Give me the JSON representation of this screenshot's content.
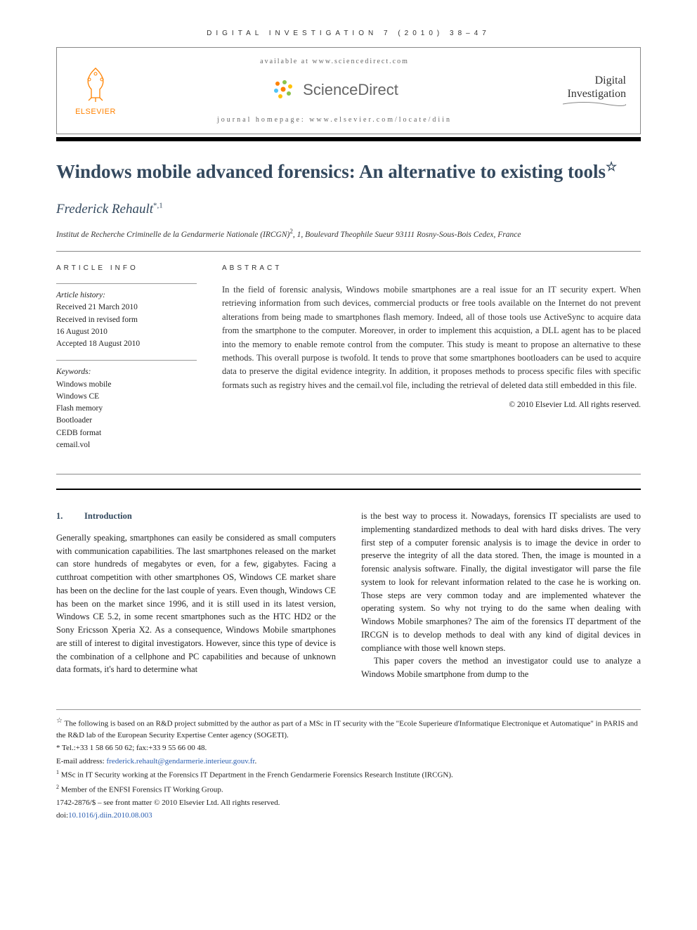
{
  "journalHeader": "DIGITAL INVESTIGATION 7 (2010) 38–47",
  "availableAt": "available at www.sciencedirect.com",
  "sdText": "ScienceDirect",
  "journalHomepage": "journal homepage: www.elsevier.com/locate/diin",
  "publisherName": "ELSEVIER",
  "journalCover": "Digital Investigation",
  "title": "Windows mobile advanced forensics: An alternative to existing tools",
  "authors": "Frederick Rehault",
  "authorMarks": "*,1",
  "affiliation": "Institut de Recherche Criminelle de la Gendarmerie Nationale (IRCGN)",
  "affiliationSup": "2",
  "affiliationRest": ", 1, Boulevard Theophile Sueur 93111 Rosny-Sous-Bois Cedex, France",
  "articleInfoHeading": "ARTICLE INFO",
  "abstractHeading": "ABSTRACT",
  "history": {
    "label": "Article history:",
    "received": "Received 21 March 2010",
    "revised1": "Received in revised form",
    "revised2": "16 August 2010",
    "accepted": "Accepted 18 August 2010"
  },
  "keywords": {
    "label": "Keywords:",
    "items": [
      "Windows mobile",
      "Windows CE",
      "Flash memory",
      "Bootloader",
      "CEDB format",
      "cemail.vol"
    ]
  },
  "abstract": "In the field of forensic analysis, Windows mobile smartphones are a real issue for an IT security expert. When retrieving information from such devices, commercial products or free tools available on the Internet do not prevent alterations from being made to smartphones flash memory. Indeed, all of those tools use ActiveSync to acquire data from the smartphone to the computer. Moreover, in order to implement this acquistion, a DLL agent has to be placed into the memory to enable remote control from the computer. This study is meant to propose an alternative to these methods. This overall purpose is twofold. It tends to prove that some smartphones bootloaders can be used to acquire data to preserve the digital evidence integrity. In addition, it proposes methods to process specific files with specific formats such as registry hives and the cemail.vol file, including the retrieval of deleted data still embedded in this file.",
  "copyright": "© 2010 Elsevier Ltd. All rights reserved.",
  "section1": {
    "num": "1.",
    "title": "Introduction"
  },
  "col1": "Generally speaking, smartphones can easily be considered as small computers with communication capabilities. The last smartphones released on the market can store hundreds of megabytes or even, for a few, gigabytes. Facing a cutthroat competition with other smartphones OS, Windows CE market share has been on the decline for the last couple of years. Even though, Windows CE has been on the market since 1996, and it is still used in its latest version, Windows CE 5.2, in some recent smartphones such as the HTC HD2 or the Sony Ericsson Xperia X2. As a consequence, Windows Mobile smartphones are still of interest to digital investigators. However, since this type of device is the combination of a cellphone and PC capabilities and because of unknown data formats, it's hard to determine what",
  "col2p1": "is the best way to process it. Nowadays, forensics IT specialists are used to implementing standardized methods to deal with hard disks drives. The very first step of a computer forensic analysis is to image the device in order to preserve the integrity of all the data stored. Then, the image is mounted in a forensic analysis software. Finally, the digital investigator will parse the file system to look for relevant information related to the case he is working on. Those steps are very common today and are implemented whatever the operating system. So why not trying to do the same when dealing with Windows Mobile smarphones? The aim of the forensics IT department of the IRCGN is to develop methods to deal with any kind of digital devices in compliance with those well known steps.",
  "col2p2": "This paper covers the method an investigator could use to analyze a Windows Mobile smartphone from dump to the",
  "footnotes": {
    "star": "The following is based on an R&D project submitted by the author as part of a MSc in IT security with the \"Ecole Superieure d'Informatique Electronique et Automatique\" in PARIS and the R&D lab of the European Security Expertise Center agency (SOGETI).",
    "tel": "* Tel.:+33 1 58 66 50 62; fax:+33 9 55 66 00 48.",
    "emailLabel": "E-mail address: ",
    "email": "frederick.rehault@gendarmerie.interieur.gouv.fr",
    "fn1": "MSc in IT Security working at the Forensics IT Department in the French Gendarmerie Forensics Research Institute (IRCGN).",
    "fn2": "Member of the ENFSI Forensics IT Working Group.",
    "issn": "1742-2876/$ – see front matter © 2010 Elsevier Ltd. All rights reserved.",
    "doiLabel": "doi:",
    "doi": "10.1016/j.diin.2010.08.003"
  }
}
